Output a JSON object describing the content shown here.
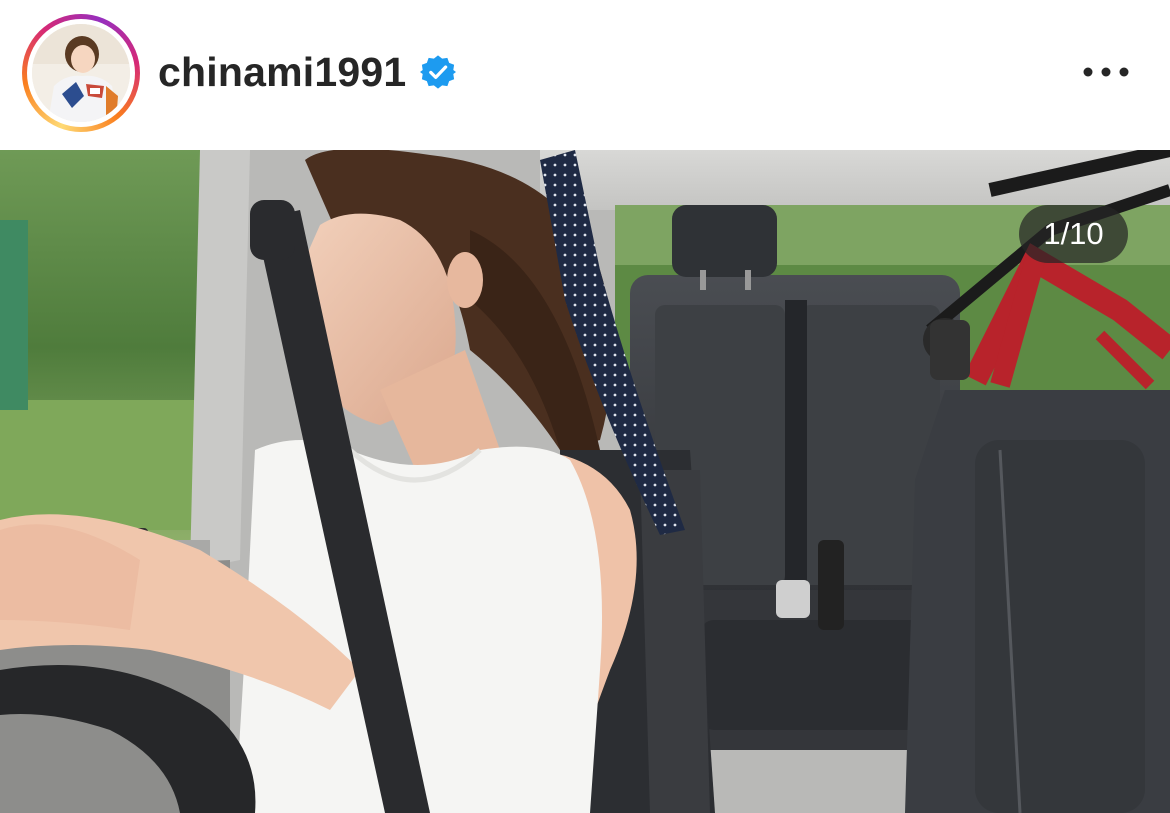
{
  "post": {
    "username": "chinami1991",
    "verified": true,
    "avatar_icon": "profile-avatar",
    "more_icon": "more-horizontal-icon"
  },
  "carousel": {
    "counter": "1/10",
    "current": 1,
    "total": 10
  },
  "colors": {
    "verified_badge": "#1d9bf0",
    "username_text": "#262626",
    "counter_bg": "#262626"
  }
}
